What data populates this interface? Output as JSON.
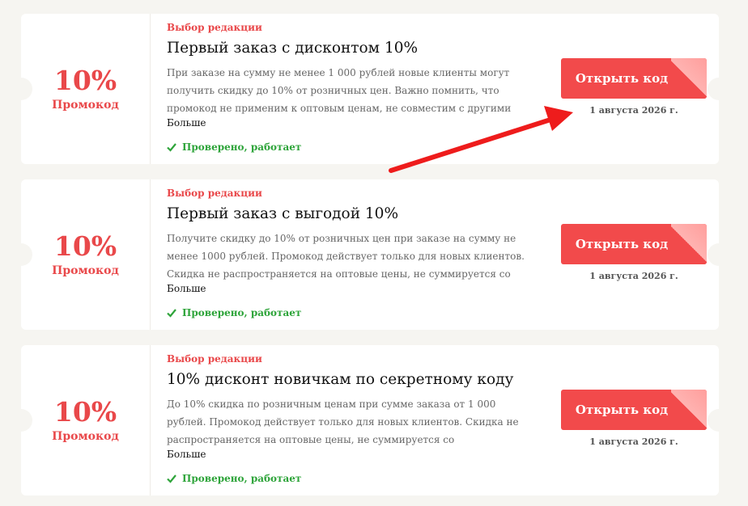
{
  "coupons": [
    {
      "discount": "10%",
      "kind": "Промокод",
      "editor_choice": "Выбор редакции",
      "title": "Первый заказ с дисконтом 10%",
      "description": "При заказе на сумму не менее 1 000 рублей новые клиенты могут получить скидку до 10% от розничных цен. Важно помнить, что промокод не применим к оптовым ценам, не совместим с другими специальными предложениями,…",
      "more": "Больше",
      "verified": "Проверено, работает",
      "button": "Открыть код",
      "date": "1 августа 2026 г."
    },
    {
      "discount": "10%",
      "kind": "Промокод",
      "editor_choice": "Выбор редакции",
      "title": "Первый заказ с выгодой 10%",
      "description": "Получите скидку до 10% от розничных цен при заказе на сумму не менее 1000 рублей. Промокод действует только для новых клиентов. Скидка не распространяется на оптовые цены, не суммируется со специальными…",
      "more": "Больше",
      "verified": "Проверено, работает",
      "button": "Открыть код",
      "date": "1 августа 2026 г."
    },
    {
      "discount": "10%",
      "kind": "Промокод",
      "editor_choice": "Выбор редакции",
      "title": "10% дисконт новичкам по секретному коду",
      "description": "До 10% скидка по розничным ценам при сумме заказа от 1 000 рублей. Промокод действует только для новых клиентов. Скидка не распространяется на оптовые цены, не суммируется со специальными предложениями, акцией…",
      "more": "Больше",
      "verified": "Проверено, работает",
      "button": "Открыть код",
      "date": "1 августа 2026 г."
    }
  ],
  "colors": {
    "accent": "#f24a4b",
    "discount_text": "#e9484a",
    "verified": "#2ea43a",
    "page_background": "#f6f5f1",
    "arrow": "#ee1c1c"
  }
}
